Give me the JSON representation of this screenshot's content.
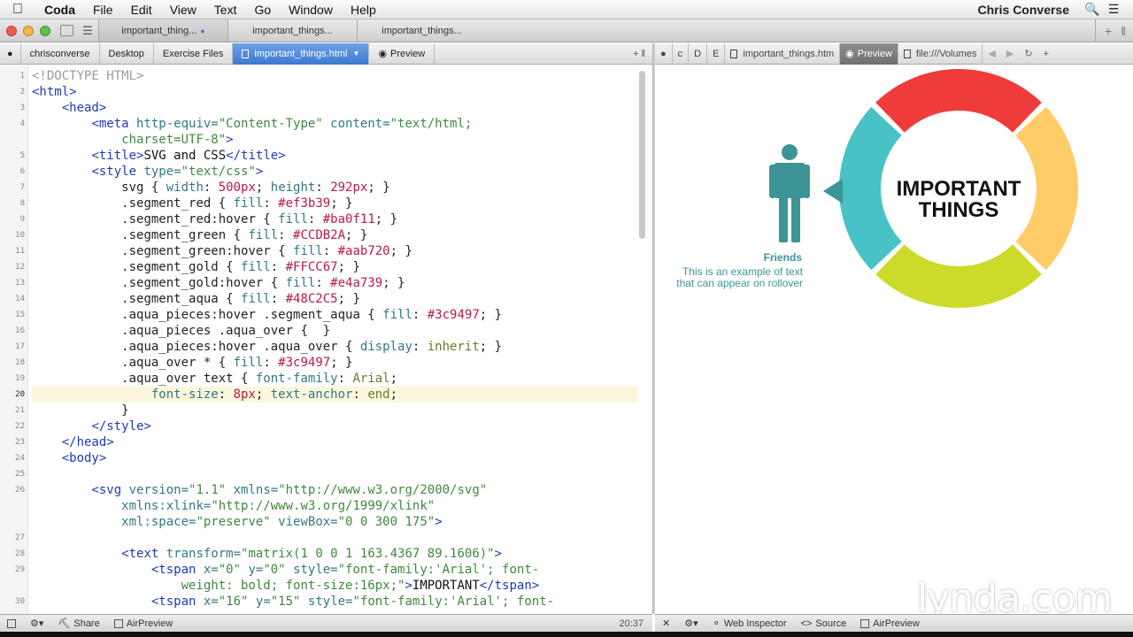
{
  "menubar": {
    "apple": "",
    "items": [
      "Coda",
      "File",
      "Edit",
      "View",
      "Text",
      "Go",
      "Window",
      "Help"
    ],
    "user": "Chris Converse"
  },
  "tabs": [
    {
      "label": "important_thing...",
      "active": true
    },
    {
      "label": "important_things...",
      "active": false
    },
    {
      "label": "important_things...",
      "active": false
    }
  ],
  "path_left": {
    "crumbs": [
      "chrisconverse",
      "Desktop",
      "Exercise Files"
    ],
    "file": "important_things.html",
    "preview": "Preview"
  },
  "path_right": {
    "crumbs": [
      "c",
      "D",
      "E"
    ],
    "file": "important_things.htm",
    "preview": "Preview",
    "url": "file:///Volumes"
  },
  "editor": {
    "current_line": 20,
    "lines": [
      {
        "n": "1",
        "i": 0,
        "tokens": [
          [
            "d",
            "<!DOCTYPE HTML>"
          ]
        ]
      },
      {
        "n": "2",
        "i": 0,
        "tokens": [
          [
            "t",
            "<html>"
          ]
        ]
      },
      {
        "n": "3",
        "i": 2,
        "tokens": [
          [
            "t",
            "<head>"
          ]
        ]
      },
      {
        "n": "4",
        "i": 4,
        "tokens": [
          [
            "t",
            "<meta "
          ],
          [
            "a",
            "http-equiv="
          ],
          [
            "s",
            "\"Content-Type\" "
          ],
          [
            "a",
            "content="
          ],
          [
            "s",
            "\"text/html;"
          ]
        ]
      },
      {
        "n": "",
        "i": 6,
        "tokens": [
          [
            "s",
            "charset=UTF-8\""
          ],
          [
            "t",
            ">"
          ]
        ]
      },
      {
        "n": "5",
        "i": 4,
        "tokens": [
          [
            "t",
            "<title>"
          ],
          [
            "x",
            "SVG and CSS"
          ],
          [
            "t",
            "</title>"
          ]
        ]
      },
      {
        "n": "6",
        "i": 4,
        "tokens": [
          [
            "t",
            "<style "
          ],
          [
            "a",
            "type="
          ],
          [
            "s",
            "\"text/css\""
          ],
          [
            "t",
            ">"
          ]
        ]
      },
      {
        "n": "7",
        "i": 6,
        "tokens": [
          [
            "p",
            "svg { "
          ],
          [
            "a",
            "width"
          ],
          [
            "p",
            ": "
          ],
          [
            "v",
            "500px"
          ],
          [
            "p",
            "; "
          ],
          [
            "a",
            "height"
          ],
          [
            "p",
            ": "
          ],
          [
            "v",
            "292px"
          ],
          [
            "p",
            "; }"
          ]
        ]
      },
      {
        "n": "8",
        "i": 6,
        "tokens": [
          [
            "p",
            ".segment_red { "
          ],
          [
            "a",
            "fill"
          ],
          [
            "p",
            ": "
          ],
          [
            "v",
            "#ef3b39"
          ],
          [
            "p",
            "; }"
          ]
        ]
      },
      {
        "n": "9",
        "i": 6,
        "tokens": [
          [
            "p",
            ".segment_red:hover { "
          ],
          [
            "a",
            "fill"
          ],
          [
            "p",
            ": "
          ],
          [
            "v",
            "#ba0f11"
          ],
          [
            "p",
            "; }"
          ]
        ]
      },
      {
        "n": "10",
        "i": 6,
        "tokens": [
          [
            "p",
            ".segment_green { "
          ],
          [
            "a",
            "fill"
          ],
          [
            "p",
            ": "
          ],
          [
            "v",
            "#CCDB2A"
          ],
          [
            "p",
            "; }"
          ]
        ]
      },
      {
        "n": "11",
        "i": 6,
        "tokens": [
          [
            "p",
            ".segment_green:hover { "
          ],
          [
            "a",
            "fill"
          ],
          [
            "p",
            ": "
          ],
          [
            "v",
            "#aab720"
          ],
          [
            "p",
            "; }"
          ]
        ]
      },
      {
        "n": "12",
        "i": 6,
        "tokens": [
          [
            "p",
            ".segment_gold { "
          ],
          [
            "a",
            "fill"
          ],
          [
            "p",
            ": "
          ],
          [
            "v",
            "#FFCC67"
          ],
          [
            "p",
            "; }"
          ]
        ]
      },
      {
        "n": "13",
        "i": 6,
        "tokens": [
          [
            "p",
            ".segment_gold:hover { "
          ],
          [
            "a",
            "fill"
          ],
          [
            "p",
            ": "
          ],
          [
            "v",
            "#e4a739"
          ],
          [
            "p",
            "; }"
          ]
        ]
      },
      {
        "n": "14",
        "i": 6,
        "tokens": [
          [
            "p",
            ".segment_aqua { "
          ],
          [
            "a",
            "fill"
          ],
          [
            "p",
            ": "
          ],
          [
            "v",
            "#48C2C5"
          ],
          [
            "p",
            "; }"
          ]
        ]
      },
      {
        "n": "15",
        "i": 6,
        "tokens": [
          [
            "p",
            ".aqua_pieces:hover .segment_aqua { "
          ],
          [
            "a",
            "fill"
          ],
          [
            "p",
            ": "
          ],
          [
            "v",
            "#3c9497"
          ],
          [
            "p",
            "; }"
          ]
        ]
      },
      {
        "n": "16",
        "i": 6,
        "tokens": [
          [
            "p",
            ".aqua_pieces .aqua_over {  }"
          ]
        ]
      },
      {
        "n": "17",
        "i": 6,
        "tokens": [
          [
            "p",
            ".aqua_pieces:hover .aqua_over { "
          ],
          [
            "a",
            "display"
          ],
          [
            "p",
            ": "
          ],
          [
            "k",
            "inherit"
          ],
          [
            "p",
            "; }"
          ]
        ]
      },
      {
        "n": "18",
        "i": 6,
        "tokens": [
          [
            "p",
            ".aqua_over * { "
          ],
          [
            "a",
            "fill"
          ],
          [
            "p",
            ": "
          ],
          [
            "v",
            "#3c9497"
          ],
          [
            "p",
            "; }"
          ]
        ]
      },
      {
        "n": "19",
        "i": 6,
        "tokens": [
          [
            "p",
            ".aqua_over text { "
          ],
          [
            "a",
            "font-family"
          ],
          [
            "p",
            ": "
          ],
          [
            "k",
            "Arial"
          ],
          [
            "p",
            ";"
          ]
        ]
      },
      {
        "n": "20",
        "i": 8,
        "tokens": [
          [
            "a",
            "font-size"
          ],
          [
            "p",
            ": "
          ],
          [
            "v",
            "8px"
          ],
          [
            "p",
            "; "
          ],
          [
            "a",
            "text-anchor"
          ],
          [
            "p",
            ": "
          ],
          [
            "k",
            "end"
          ],
          [
            "p",
            ";"
          ]
        ]
      },
      {
        "n": "21",
        "i": 6,
        "tokens": [
          [
            "p",
            "}"
          ]
        ]
      },
      {
        "n": "22",
        "i": 4,
        "tokens": [
          [
            "t",
            "</style>"
          ]
        ]
      },
      {
        "n": "23",
        "i": 2,
        "tokens": [
          [
            "t",
            "</head>"
          ]
        ]
      },
      {
        "n": "24",
        "i": 2,
        "tokens": [
          [
            "t",
            "<body>"
          ]
        ]
      },
      {
        "n": "25",
        "i": 0,
        "tokens": []
      },
      {
        "n": "26",
        "i": 4,
        "tokens": [
          [
            "t",
            "<svg "
          ],
          [
            "a",
            "version="
          ],
          [
            "s",
            "\"1.1\" "
          ],
          [
            "a",
            "xmlns="
          ],
          [
            "s",
            "\"http://www.w3.org/2000/svg\""
          ]
        ]
      },
      {
        "n": "",
        "i": 6,
        "tokens": [
          [
            "a",
            "xmlns:xlink="
          ],
          [
            "s",
            "\"http://www.w3.org/1999/xlink\""
          ]
        ]
      },
      {
        "n": "",
        "i": 6,
        "tokens": [
          [
            "a",
            "xml:space="
          ],
          [
            "s",
            "\"preserve\" "
          ],
          [
            "a",
            "viewBox="
          ],
          [
            "s",
            "\"0 0 300 175\""
          ],
          [
            "t",
            ">"
          ]
        ]
      },
      {
        "n": "27",
        "i": 0,
        "tokens": []
      },
      {
        "n": "28",
        "i": 6,
        "tokens": [
          [
            "t",
            "<text "
          ],
          [
            "a",
            "transform="
          ],
          [
            "s",
            "\"matrix(1 0 0 1 163.4367 89.1606)\""
          ],
          [
            "t",
            ">"
          ]
        ]
      },
      {
        "n": "29",
        "i": 8,
        "tokens": [
          [
            "t",
            "<tspan "
          ],
          [
            "a",
            "x="
          ],
          [
            "s",
            "\"0\" "
          ],
          [
            "a",
            "y="
          ],
          [
            "s",
            "\"0\" "
          ],
          [
            "a",
            "style="
          ],
          [
            "s",
            "\"font-family:'Arial'; font-"
          ]
        ]
      },
      {
        "n": "",
        "i": 10,
        "tokens": [
          [
            "s",
            "weight: bold; font-size:16px;\""
          ],
          [
            "t",
            ">"
          ],
          [
            "x",
            "IMPORTANT"
          ],
          [
            "t",
            "</tspan>"
          ]
        ]
      },
      {
        "n": "30",
        "i": 8,
        "tokens": [
          [
            "t",
            "<tspan "
          ],
          [
            "a",
            "x="
          ],
          [
            "s",
            "\"16\" "
          ],
          [
            "a",
            "y="
          ],
          [
            "s",
            "\"15\" "
          ],
          [
            "a",
            "style="
          ],
          [
            "s",
            "\"font-family:'Arial'; font-"
          ]
        ]
      }
    ]
  },
  "preview": {
    "title_line1": "IMPORTANT",
    "title_line2": "THINGS",
    "caption_title": "Friends",
    "caption_line1": "This is an example of text",
    "caption_line2": "that can appear on rollover",
    "colors": {
      "red": "#ef3b39",
      "gold": "#FFCC67",
      "green": "#CCDB2A",
      "aqua": "#48C2C5",
      "aqua_dark": "#3c9497"
    }
  },
  "watermark": "lynda.com",
  "status_left": {
    "share": "Share",
    "airpreview": "AirPreview",
    "cursor": "20:37"
  },
  "status_right": {
    "web_inspector": "Web Inspector",
    "source": "Source",
    "airpreview": "AirPreview"
  }
}
